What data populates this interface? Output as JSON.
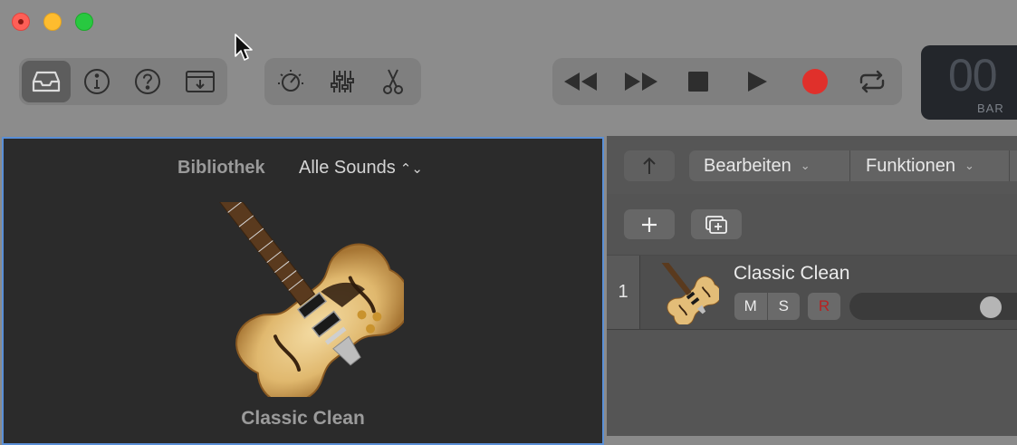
{
  "window": {
    "traffic_lights": [
      "close",
      "minimize",
      "zoom"
    ]
  },
  "toolbar": {
    "view_group": [
      {
        "icon": "inbox-tray-icon",
        "active": true
      },
      {
        "icon": "info-icon",
        "active": false
      },
      {
        "icon": "help-question-icon",
        "active": false
      },
      {
        "icon": "download-tray-icon",
        "active": false
      }
    ],
    "edit_group": [
      {
        "icon": "smart-controls-dial-icon"
      },
      {
        "icon": "mixer-sliders-icon"
      },
      {
        "icon": "scissors-icon"
      }
    ],
    "transport": [
      {
        "icon": "rewind-icon"
      },
      {
        "icon": "fast-forward-icon"
      },
      {
        "icon": "stop-icon"
      },
      {
        "icon": "play-icon"
      },
      {
        "icon": "record-icon",
        "color": "#e0302b"
      },
      {
        "icon": "cycle-loop-icon"
      }
    ],
    "lcd": {
      "value": "00",
      "unit": "BAR"
    }
  },
  "library": {
    "title": "Bibliothek",
    "filter": "Alle Sounds",
    "selected_patch": "Classic Clean",
    "accent_border": "#5a8fd6"
  },
  "tracks": {
    "menus": {
      "edit": "Bearbeiten",
      "functions": "Funktionen"
    },
    "rows": [
      {
        "number": "1",
        "name": "Classic Clean",
        "mute_label": "M",
        "solo_label": "S",
        "record_label": "R",
        "volume_level": 0.78
      }
    ]
  }
}
